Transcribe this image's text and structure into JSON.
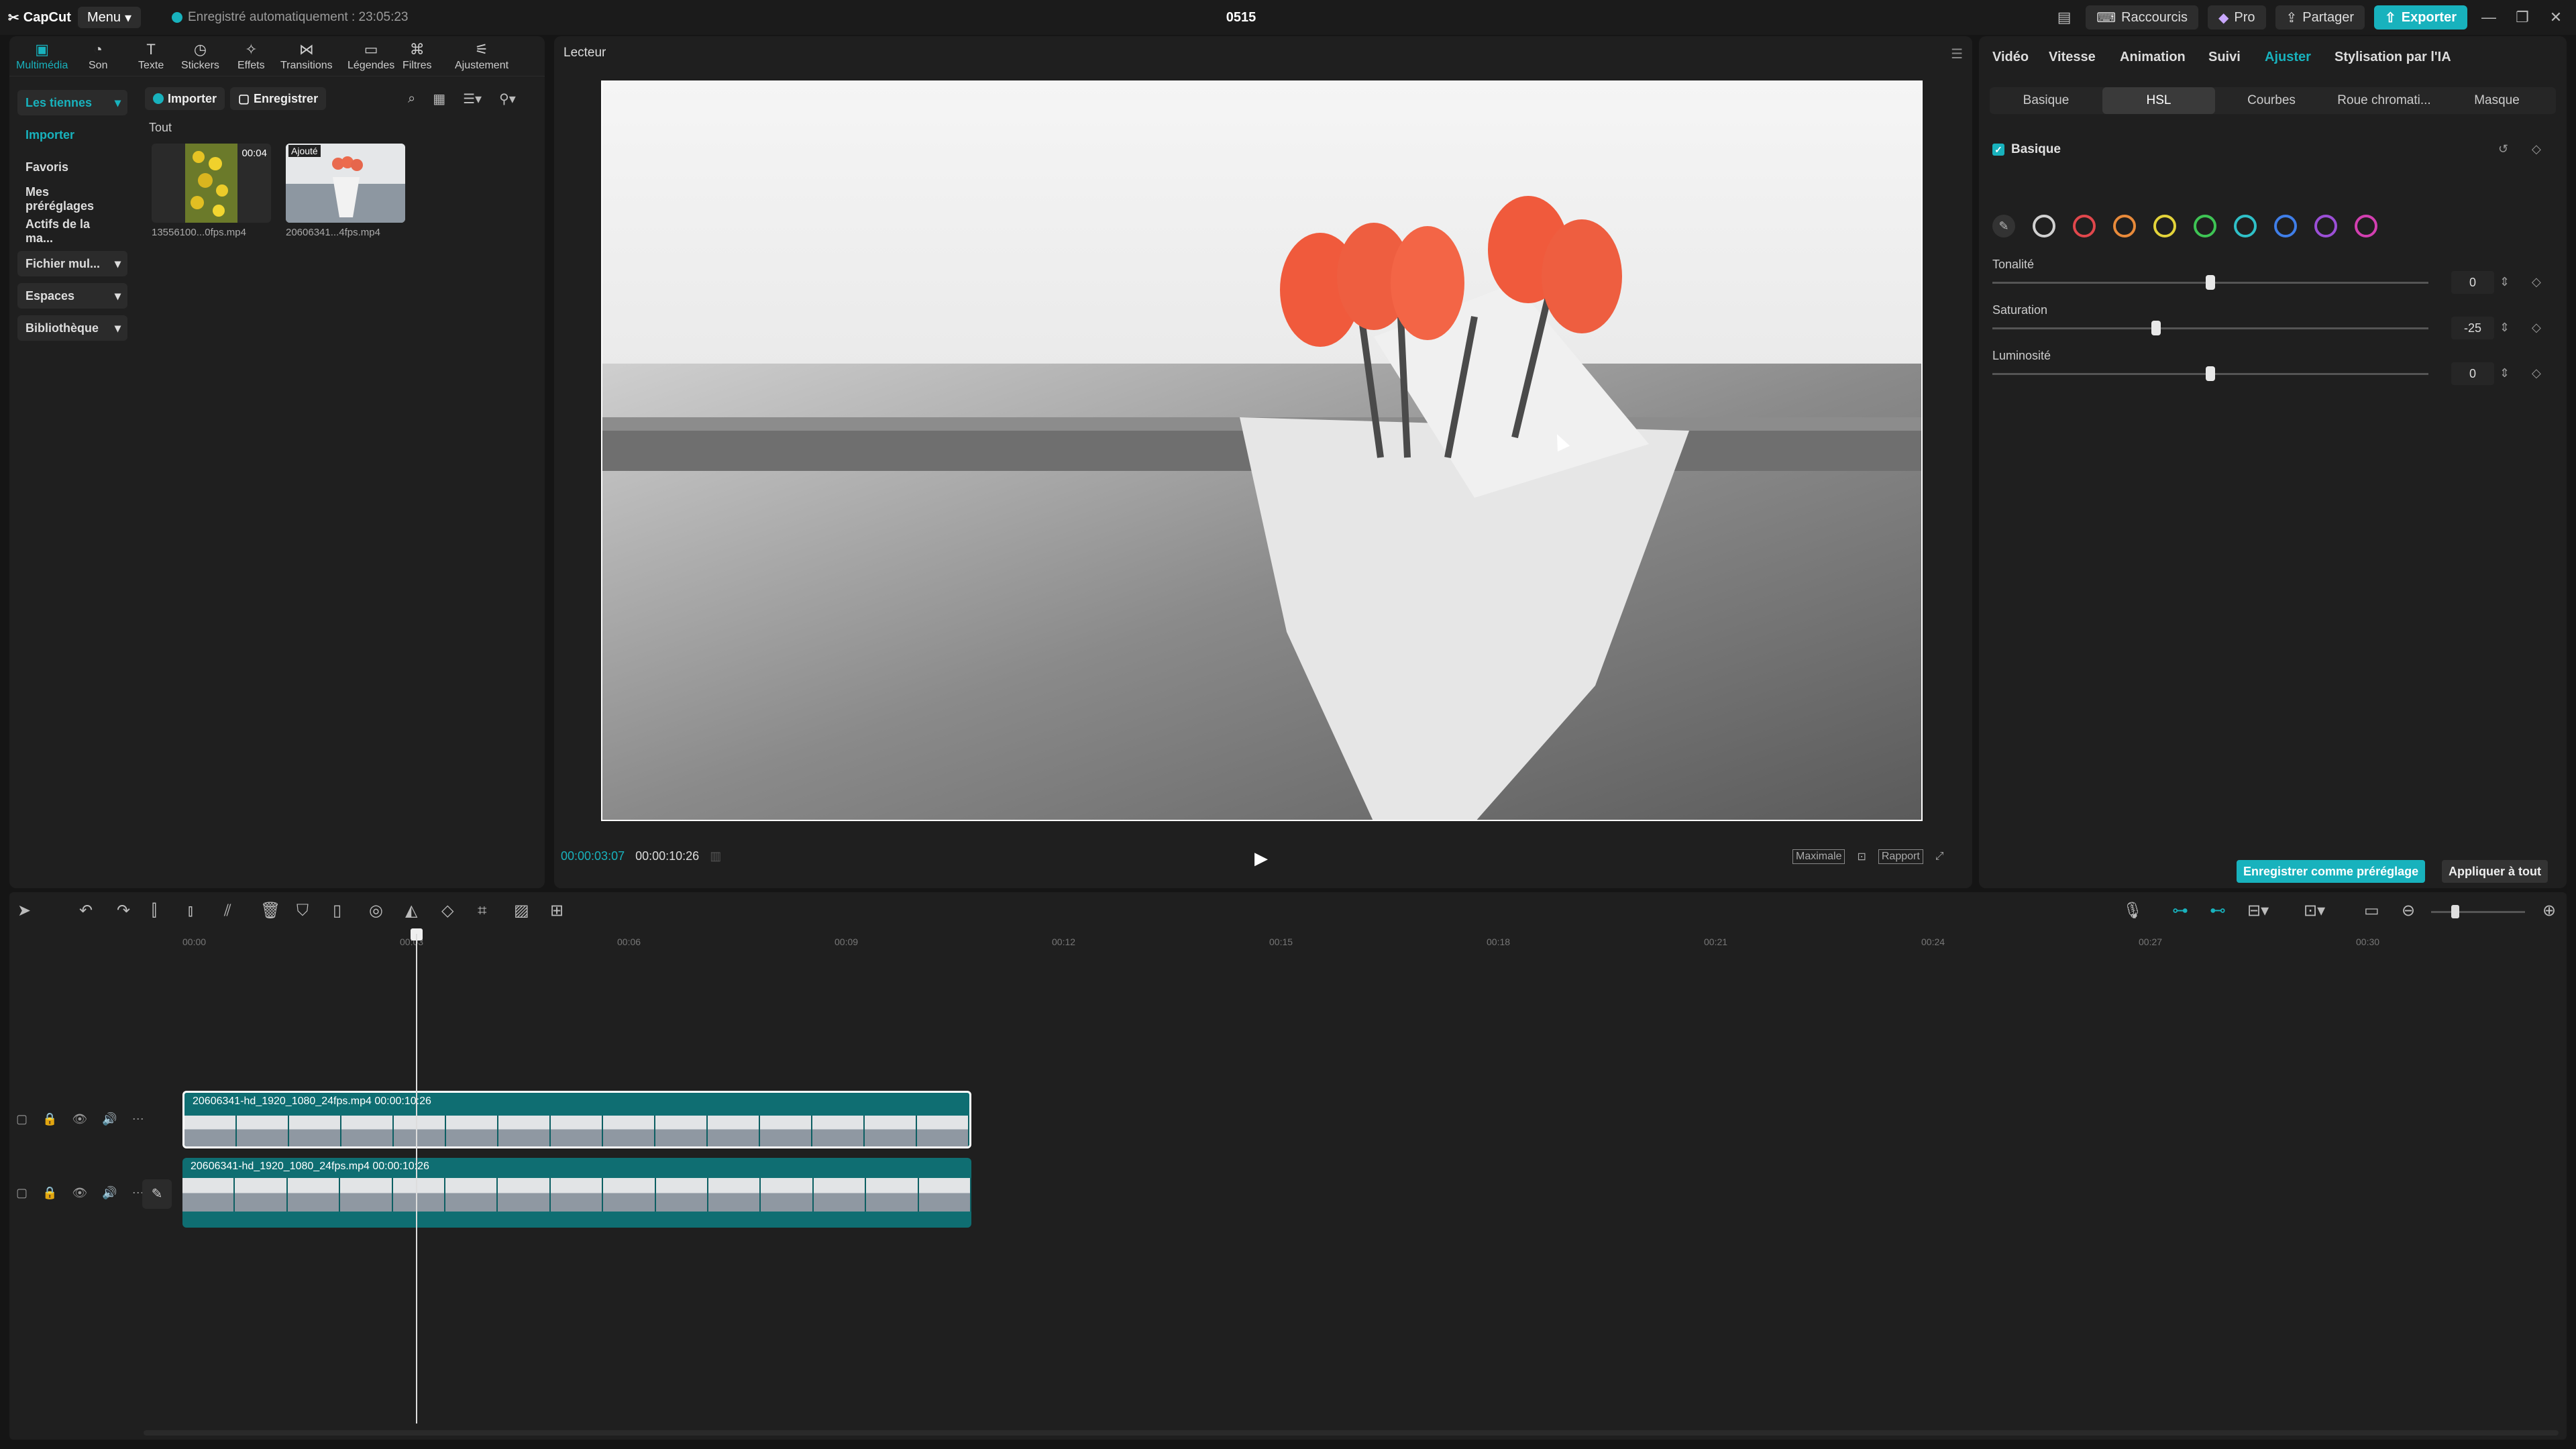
{
  "app": {
    "name": "CapCut",
    "menu_label": "Menu",
    "autosave": "Enregistré automatiquement : 23:05:23",
    "project_title": "0515"
  },
  "topbar": {
    "shortcuts": "Raccourcis",
    "pro": "Pro",
    "share": "Partager",
    "export": "Exporter"
  },
  "tools": [
    {
      "label": "Multimédia",
      "icon": "media-icon"
    },
    {
      "label": "Son",
      "icon": "music-icon"
    },
    {
      "label": "Texte",
      "icon": "text-icon"
    },
    {
      "label": "Stickers",
      "icon": "sticker-icon"
    },
    {
      "label": "Effets",
      "icon": "effects-icon"
    },
    {
      "label": "Transitions",
      "icon": "transition-icon"
    },
    {
      "label": "Légendes",
      "icon": "captions-icon"
    },
    {
      "label": "Filtres",
      "icon": "filter-icon"
    },
    {
      "label": "Ajustement",
      "icon": "adjust-icon"
    }
  ],
  "sidebar": {
    "items": [
      {
        "label": "Les tiennes"
      },
      {
        "label": "Importer"
      },
      {
        "label": "Favoris"
      },
      {
        "label": "Mes préréglages"
      },
      {
        "label": "Actifs de la ma..."
      },
      {
        "label": "Fichier mul..."
      },
      {
        "label": "Espaces"
      },
      {
        "label": "Bibliothèque"
      }
    ]
  },
  "media": {
    "import_btn": "Importer",
    "record_btn": "Enregistrer",
    "filter_all": "Tout",
    "items": [
      {
        "name": "13556100...0fps.mp4",
        "duration": "00:04"
      },
      {
        "name": "20606341...4fps.mp4",
        "badge": "Ajouté"
      }
    ]
  },
  "player": {
    "label": "Lecteur",
    "current_time": "00:00:03:07",
    "total_time": "00:00:10:26",
    "quality": "Maximale",
    "ratio": "Rapport"
  },
  "inspector": {
    "tabs": [
      "Vidéo",
      "Vitesse",
      "Animation",
      "Suivi",
      "Ajuster",
      "Stylisation par l'IA"
    ],
    "sub_tabs": [
      "Basique",
      "HSL",
      "Courbes",
      "Roue chromati...",
      "Masque"
    ],
    "section": "Basique",
    "swatches": [
      "#d0d0d0",
      "#e0474c",
      "#e88a3a",
      "#e3d33a",
      "#3ec454",
      "#2fc0c8",
      "#3f7ee8",
      "#9b4fd6",
      "#d23fb0"
    ],
    "sliders": [
      {
        "label": "Tonalité",
        "value": "0",
        "fraction": 0.5
      },
      {
        "label": "Saturation",
        "value": "-25",
        "fraction": 0.375
      },
      {
        "label": "Luminosité",
        "value": "0",
        "fraction": 0.5
      }
    ],
    "save_preset": "Enregistrer comme préréglage",
    "apply_all": "Appliquer à tout"
  },
  "timeline": {
    "ticks": [
      "00:00",
      "00:03",
      "00:06",
      "00:09",
      "00:12",
      "00:15",
      "00:18",
      "00:21",
      "00:24",
      "00:27",
      "00:30"
    ],
    "tracks": [
      {
        "label": "20606341-hd_1920_1080_24fps.mp4  00:00:10:26"
      },
      {
        "label": "20606341-hd_1920_1080_24fps.mp4  00:00:10:26"
      }
    ]
  }
}
